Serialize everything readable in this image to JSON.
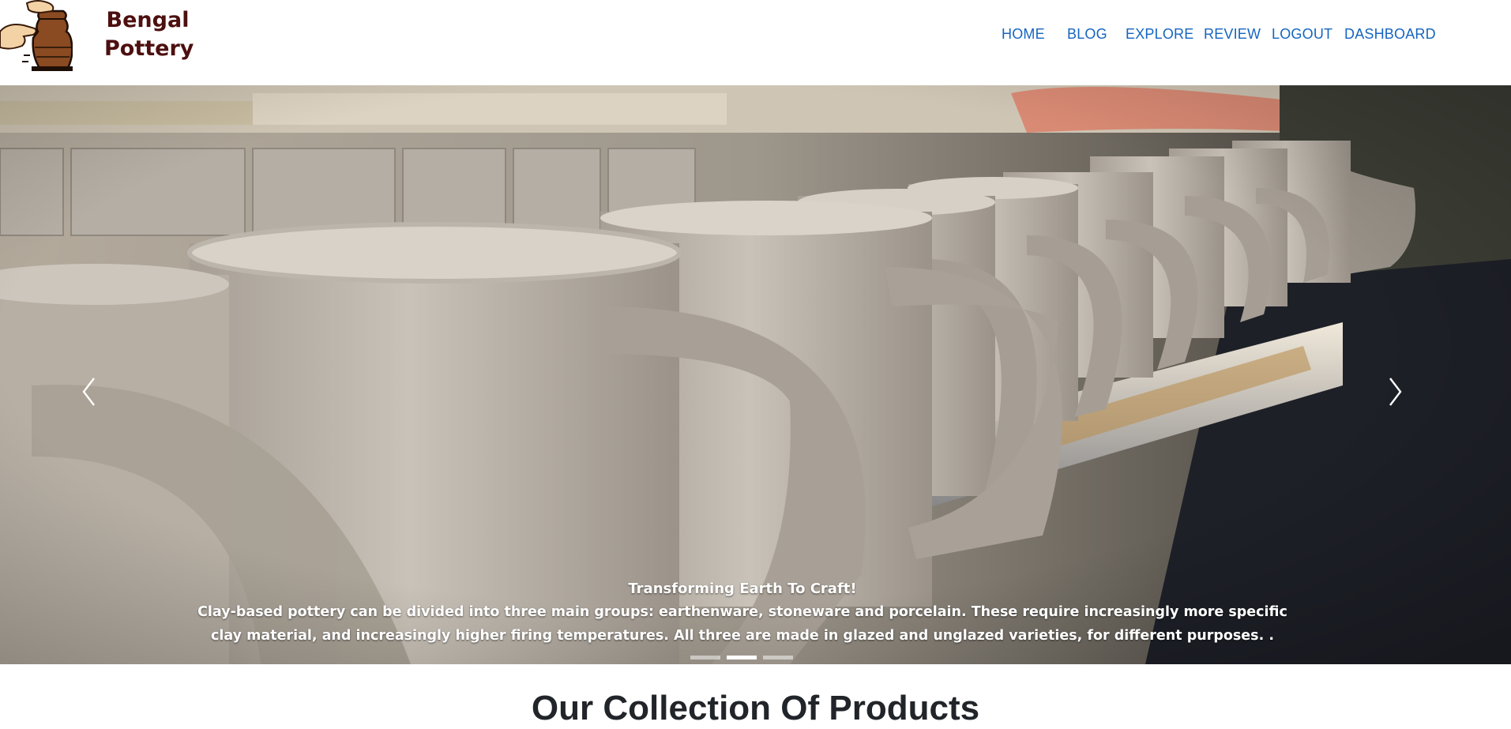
{
  "brand": {
    "line1": "Bengal",
    "line2": "Pottery",
    "color": "#4d0f0f"
  },
  "nav": {
    "home": "HOME",
    "blog": "BLOG",
    "explore": "EXPLORE",
    "review": "REVIEW",
    "logout": "LOGOUT",
    "dashboard": "DASHBOARD",
    "link_color": "#1565c0"
  },
  "carousel": {
    "caption_title": "Transforming Earth To Craft!",
    "caption_text": "Clay-based pottery can be divided into three main groups: earthenware, stoneware and porcelain. These require increasingly more specific clay material, and increasingly higher firing temperatures. All three are made in glazed and unglazed varieties, for different purposes. .",
    "slide_count": 3,
    "active_slide": 2,
    "prev_icon": "chevron-left-icon",
    "next_icon": "chevron-right-icon"
  },
  "section": {
    "title": "Our Collection Of Products"
  }
}
